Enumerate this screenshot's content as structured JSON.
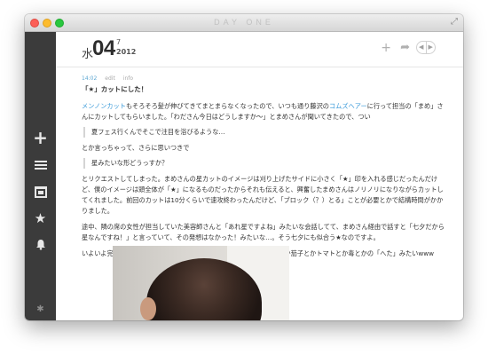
{
  "app": {
    "title": "DAY ONE"
  },
  "header": {
    "weekday": "水",
    "day": "04",
    "month": "7",
    "year": "2012"
  },
  "entry": {
    "time": "14:02",
    "edit": "edit",
    "info": "info",
    "title": "「★」カットにした！",
    "p1_link1": "メンノンカット",
    "p1_text1": "もそろそろ髪が伸びてきてまとまらなくなったので、いつも通り藤沢の",
    "p1_link2": "コムズヘアー",
    "p1_text2": "に行って担当の「まめ」さんにカットしてもらいました。「わださん今日はどうしますか〜」とまめさんが聞いてきたので、つい",
    "quote1": "夏フェス行くんでそこで注目を浴びるような…",
    "p2": "とか言っちゃって、さらに思いつきで",
    "quote2": "星みたいな形どうっすか？",
    "p3": "とリクエストしてしまった。まめさんの星カットのイメージは刈り上げたサイドに小さく「★」印を入れる感じだったんだけど、僕のイメージは頭全体が「★」になるものだったからそれも伝えると、興奮したまめさんはノリノリになりながらカットしてくれました。前回のカットは10分くらいで速攻終わったんだけど、「ブロック（？）とる」ことが必要とかで結構時間がかかりました。",
    "p4": "途中、隣の席の女性が担当していた美容師さんと「あれ星ですよね」みたいな会話してて、まめさん経由で話すと「七夕だから星なんですね！」と言っていて、その発想はなかった！みたいな…。そう七夕にも似合う★なのですよ。",
    "p5": "いよいよ完成。真上から見ると奇麗な★なんだけど、横から見るとなんか茄子とかトマトとか毒とかの「へた」みたいwww"
  },
  "icons": {
    "add": "plus-icon",
    "list": "list-icon",
    "calendar": "calendar-icon",
    "starred": "star-icon",
    "reminders": "bell-icon",
    "settings": "gear-icon",
    "share": "share-icon",
    "fullscreen": "fullscreen-icon"
  },
  "colors": {
    "sidebar": "#3b3b3b",
    "link": "#3a9ad9",
    "time": "#5fa8d3"
  }
}
